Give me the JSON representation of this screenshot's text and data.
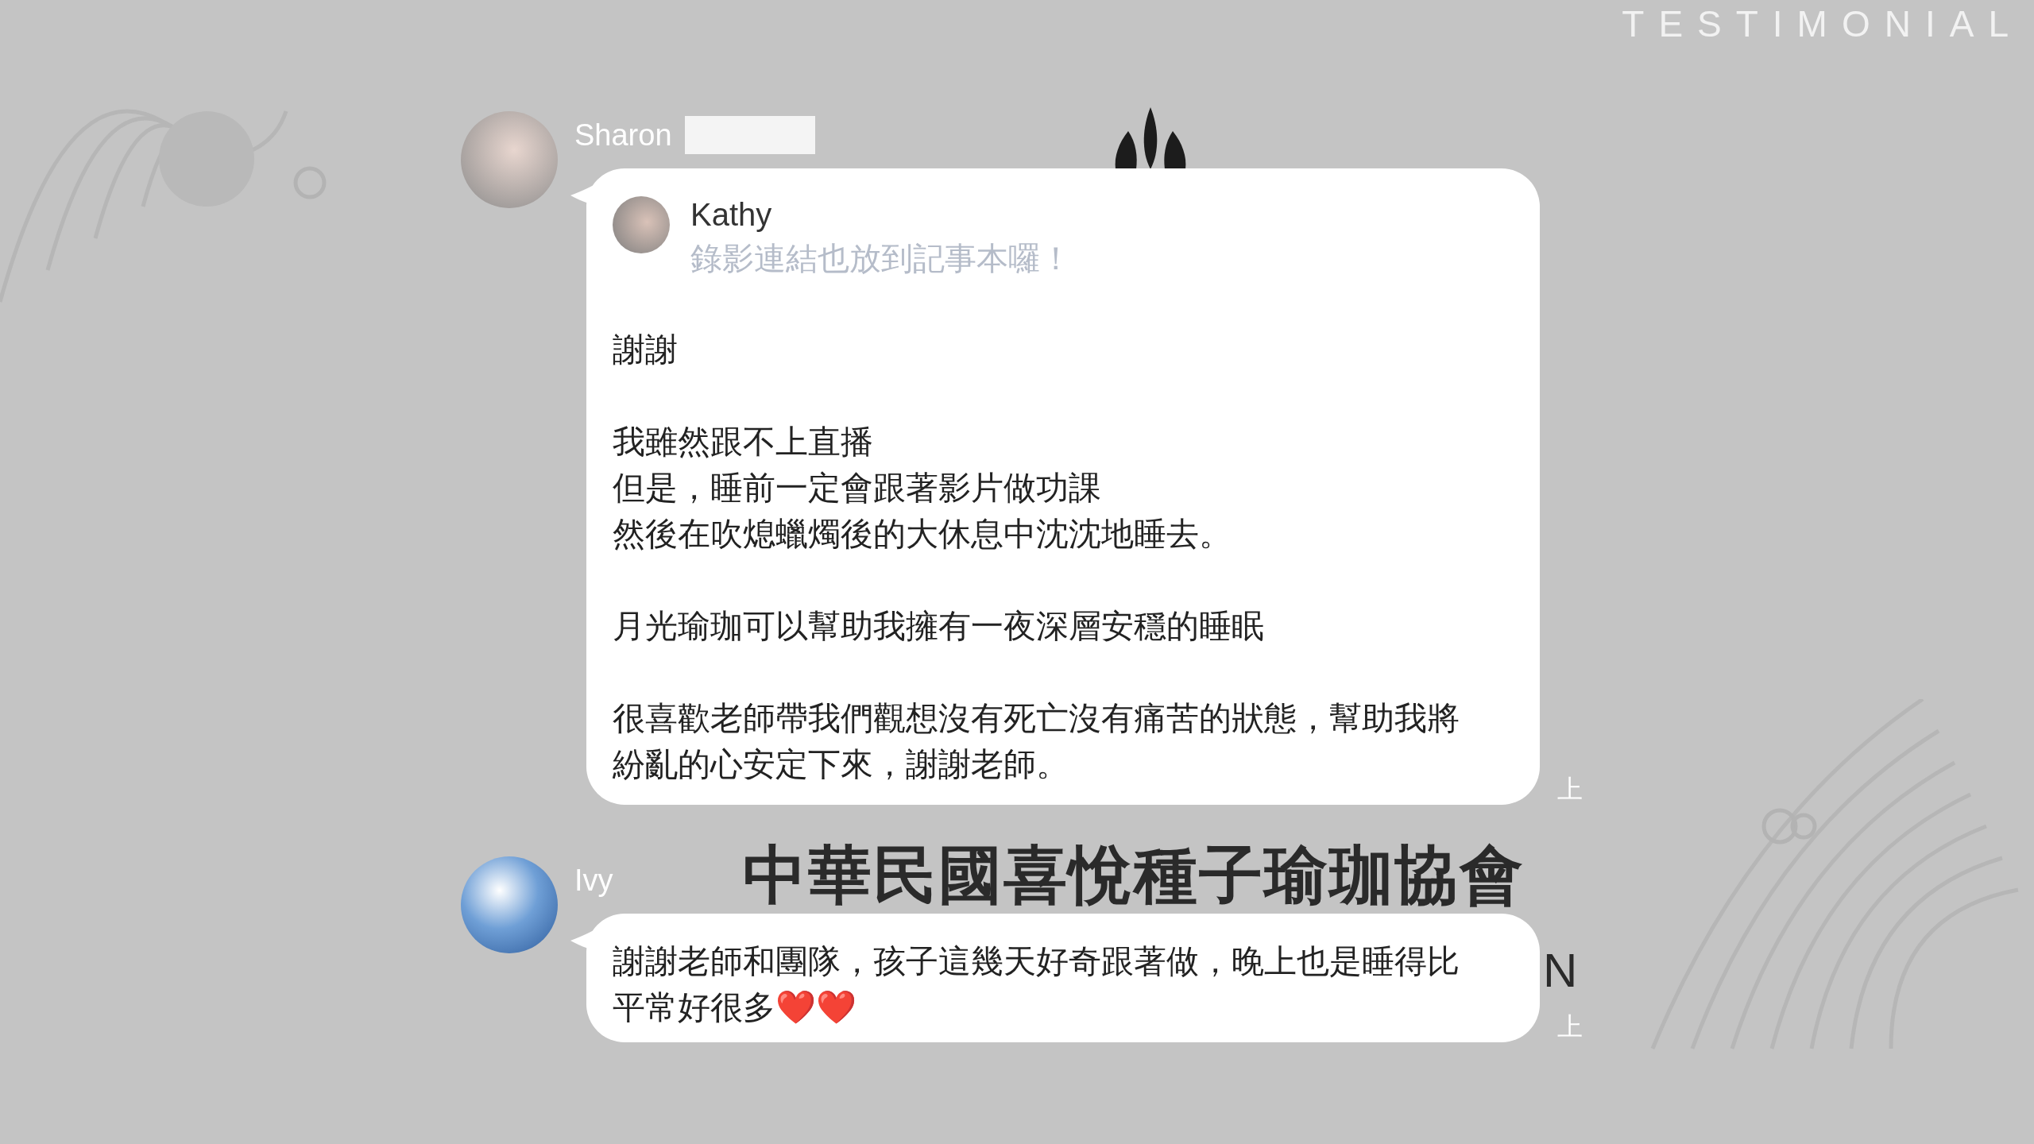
{
  "header": {
    "title": "TESTIMONIAL"
  },
  "background": {
    "org_name": "中華民國喜悅種子瑜珈協會",
    "fragment": "N"
  },
  "messages": [
    {
      "sender": "Sharon",
      "name_redacted": true,
      "reply": {
        "sender": "Kathy",
        "text": "錄影連結也放到記事本囉！"
      },
      "paragraphs": [
        [
          "謝謝"
        ],
        [
          "我雖然跟不上直播",
          "但是，睡前一定會跟著影片做功課",
          "然後在吹熄蠟燭後的大休息中沈沈地睡去。"
        ],
        [
          "月光瑜珈可以幫助我擁有一夜深層安穩的睡眠"
        ],
        [
          "很喜歡老師帶我們觀想沒有死亡沒有痛苦的狀態，幫助我將紛亂的心安定下來，謝謝老師。"
        ]
      ],
      "time": "上"
    },
    {
      "sender": "Ivy",
      "name_redacted": false,
      "paragraphs": [
        [
          "謝謝老師和團隊，孩子這幾天好奇跟著做，晚上也是睡得比平常好很多❤️❤️"
        ]
      ],
      "time": "上"
    }
  ]
}
